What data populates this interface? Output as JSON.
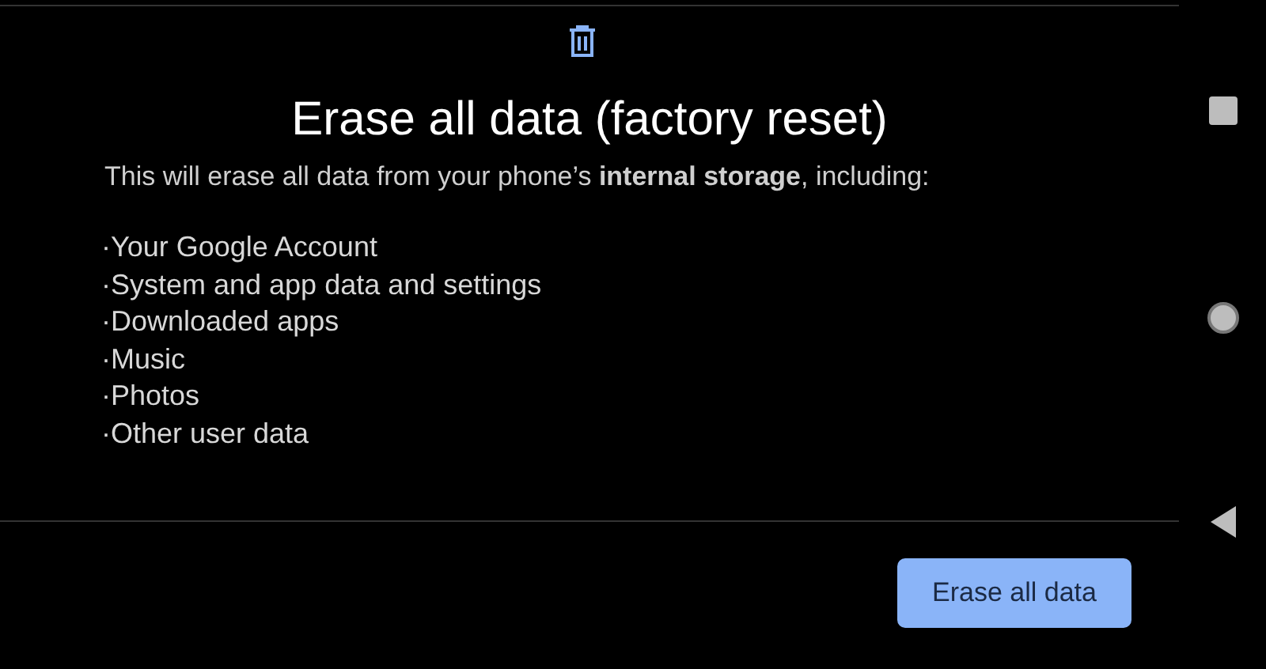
{
  "title": "Erase all data (factory reset)",
  "description": "This will erase all data from your phone’s **internal storage**, including:",
  "items": [
    "·Your Google Account",
    "·System and app data and settings",
    "·Downloaded apps",
    "·Music",
    "·Photos",
    "·Other user data"
  ],
  "button": "Erase all data"
}
